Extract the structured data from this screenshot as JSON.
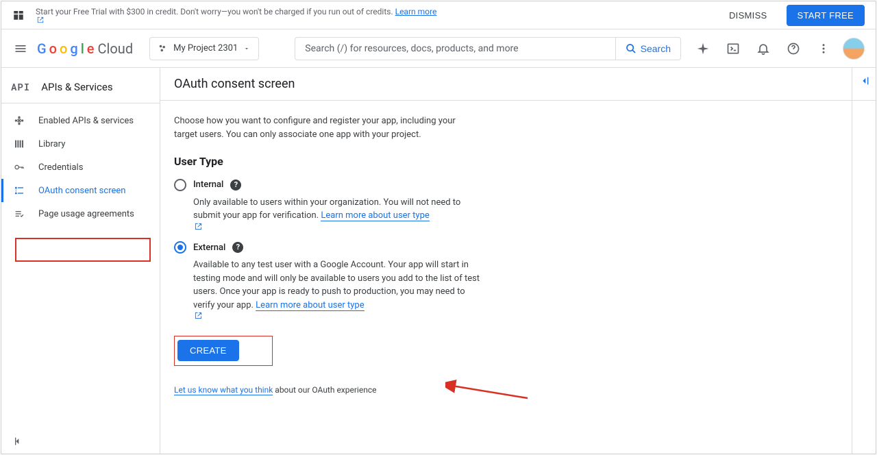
{
  "banner": {
    "text": "Start your Free Trial with $300 in credit. Don't worry—you won't be charged if you run out of credits. ",
    "learn_more": "Learn more",
    "dismiss": "DISMISS",
    "start_free": "START FREE"
  },
  "header": {
    "logo_cloud": "Cloud",
    "project_name": "My Project 2301",
    "search_placeholder": "Search (/) for resources, docs, products, and more",
    "search_button": "Search"
  },
  "sidebar": {
    "api_badge": "API",
    "title": "APIs & Services",
    "items": [
      {
        "label": "Enabled APIs & services"
      },
      {
        "label": "Library"
      },
      {
        "label": "Credentials"
      },
      {
        "label": "OAuth consent screen"
      },
      {
        "label": "Page usage agreements"
      }
    ]
  },
  "content": {
    "page_title": "OAuth consent screen",
    "intro": "Choose how you want to configure and register your app, including your target users. You can only associate one app with your project.",
    "user_type_heading": "User Type",
    "internal": {
      "label": "Internal",
      "desc": "Only available to users within your organization. You will not need to submit your app for verification. ",
      "link": "Learn more about user type"
    },
    "external": {
      "label": "External",
      "desc1": "Available to any test user with a Google Account. Your app will start in testing mode and will only be available to users you add to the list of test users. Once your app is ready to push to production, you may need to verify your app. ",
      "link": "Learn more about user type"
    },
    "create_button": "CREATE",
    "feedback_link": "Let us know what you think",
    "feedback_suffix": " about our OAuth experience"
  }
}
